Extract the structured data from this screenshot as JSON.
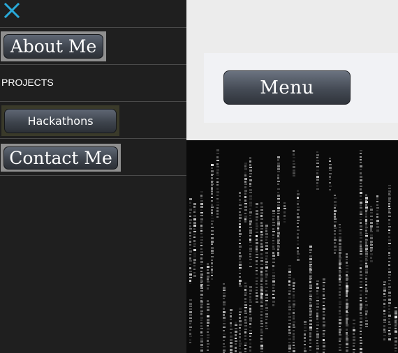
{
  "nav": {
    "close_icon": "close-icon",
    "about_label": "About Me",
    "projects_label": "PROJECTS",
    "hackathons_label": "Hackathons",
    "contact_label": "Contact Me"
  },
  "main": {
    "menu_label": "Menu"
  },
  "colors": {
    "close_icon": "#29a9d8",
    "drawer_bg": "#1f1f1f",
    "page_bg": "#ececec"
  }
}
